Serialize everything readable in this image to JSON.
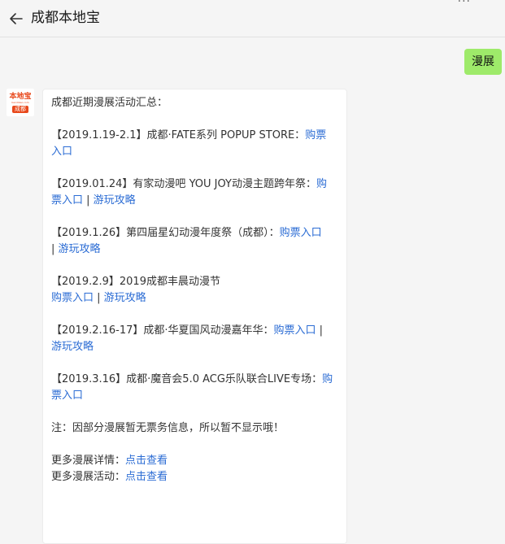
{
  "header": {
    "title": "成都本地宝",
    "more": "···"
  },
  "chat": {
    "my_message": "漫展",
    "avatar": {
      "top_text": "本地宝",
      "url_text": "bendibao.com",
      "badge": "成都"
    },
    "reply": {
      "intro": "成都近期漫展活动汇总：",
      "events": [
        {
          "line1": "【2019.1.19-2.1】成都·FATE系列 POPUP STORE：",
          "link_a": "购票",
          "link_b": "入口"
        },
        {
          "line1": "【2019.01.24】有家动漫吧 YOU JOY动漫主题跨年祭：",
          "link_a": "购",
          "link_b": "票入口",
          "sep": " | ",
          "link_c": "游玩攻略"
        },
        {
          "line1": "【2019.1.26】第四届星幻动漫年度祭（成都）：",
          "link_a": "购票入口",
          "sep": "| ",
          "link_c": "游玩攻略"
        },
        {
          "line1": "【2019.2.9】2019成都丰晨动漫节",
          "link_a": "购票入口",
          "sep": " | ",
          "link_c": "游玩攻略"
        },
        {
          "line1": "【2019.2.16-17】成都·华夏国风动漫嘉年华：",
          "link_a": "购票入口",
          "sep": " |",
          "link_c": "游玩攻略"
        },
        {
          "line1": "【2019.3.16】成都·魔音会5.0 ACG乐队联合LIVE专场：",
          "link_a": "购",
          "link_b": "票入口"
        }
      ],
      "note": "注：因部分漫展暂无票务信息，所以暂不显示哦！",
      "more_details_label": "更多漫展详情：",
      "more_details_link": "点击查看",
      "more_events_label": "更多漫展活动：",
      "more_events_link": "点击查看"
    }
  },
  "colors": {
    "background": "#f5f5f5",
    "bubble_self": "#9eea6a",
    "bubble_other": "#ffffff",
    "link": "#2b6cd4",
    "brand": "#e8481b"
  }
}
